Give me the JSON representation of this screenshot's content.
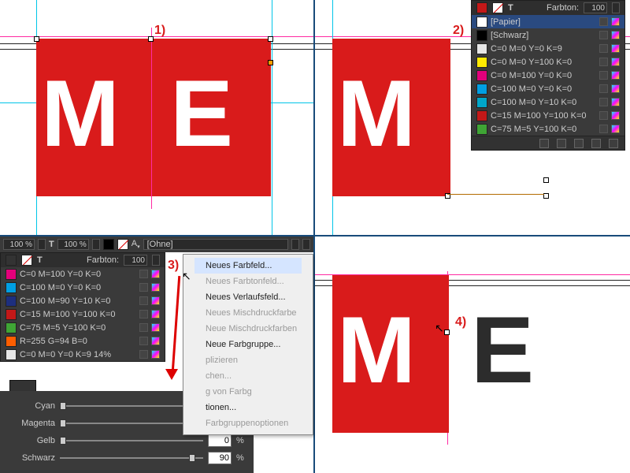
{
  "nums": {
    "n1": "1)",
    "n2": "2)",
    "n3": "3)",
    "n4": "4)"
  },
  "letters": {
    "M": "M",
    "E": "E"
  },
  "swatch_panel": {
    "tint_label": "Farbton:",
    "tint_value": "100",
    "rows": [
      {
        "label": "[Papier]",
        "color": "#ffffff"
      },
      {
        "label": "[Schwarz]",
        "color": "#000000"
      },
      {
        "label": "C=0 M=0 Y=0 K=9",
        "color": "#e6e6e6"
      },
      {
        "label": "C=0 M=0 Y=100 K=0",
        "color": "#ffea00"
      },
      {
        "label": "C=0 M=100 Y=0 K=0",
        "color": "#e3007b"
      },
      {
        "label": "C=100 M=0 Y=0 K=0",
        "color": "#009fe3"
      },
      {
        "label": "C=100 M=0 Y=10 K=0",
        "color": "#00a6c9"
      },
      {
        "label": "C=15 M=100 Y=100 K=0",
        "color": "#c31818"
      },
      {
        "label": "C=75 M=5 Y=100 K=0",
        "color": "#3fa535"
      }
    ]
  },
  "q3_panel": {
    "pct1": "100 %",
    "pct2": "100 %",
    "ohne": "[Ohne]",
    "tint_label": "Farbton:",
    "tint_value": "100",
    "rows": [
      {
        "label": "C=0 M=100 Y=0 K=0",
        "color": "#e3007b"
      },
      {
        "label": "C=100 M=0 Y=0 K=0",
        "color": "#009fe3"
      },
      {
        "label": "C=100 M=90 Y=10 K=0",
        "color": "#1d2f7f"
      },
      {
        "label": "C=15 M=100 Y=100 K=0",
        "color": "#c31818"
      },
      {
        "label": "C=75 M=5 Y=100 K=0",
        "color": "#3fa535"
      },
      {
        "label": "R=255 G=94 B=0",
        "color": "#ff5e00"
      },
      {
        "label": "C=0 M=0 Y=0 K=9 14%",
        "color": "#e6e6e6"
      }
    ]
  },
  "cmyk": {
    "channels": [
      {
        "name": "Cyan",
        "value": "0",
        "pos": 0
      },
      {
        "name": "Magenta",
        "value": "0",
        "pos": 0
      },
      {
        "name": "Gelb",
        "value": "0",
        "pos": 0
      },
      {
        "name": "Schwarz",
        "value": "90",
        "pos": 90
      }
    ],
    "pct": "%"
  },
  "menu": {
    "items": [
      {
        "label": "Neues Farbfeld...",
        "enabled": true,
        "hover": true
      },
      {
        "label": "Neues Farbtonfeld...",
        "enabled": false
      },
      {
        "label": "Neues Verlaufsfeld...",
        "enabled": true
      },
      {
        "label": "Neues Mischdruckfarbe",
        "enabled": false
      },
      {
        "label": "Neue Mischdruckfarben",
        "enabled": false
      },
      {
        "label": "Neue Farbgruppe...",
        "enabled": true
      },
      {
        "label": "plizieren",
        "enabled": false
      },
      {
        "label": "chen...",
        "enabled": false
      },
      {
        "label": "g von Farbg",
        "enabled": false
      },
      {
        "label": "tionen...",
        "enabled": true
      },
      {
        "label": "Farbgruppenoptionen",
        "enabled": false
      }
    ]
  }
}
